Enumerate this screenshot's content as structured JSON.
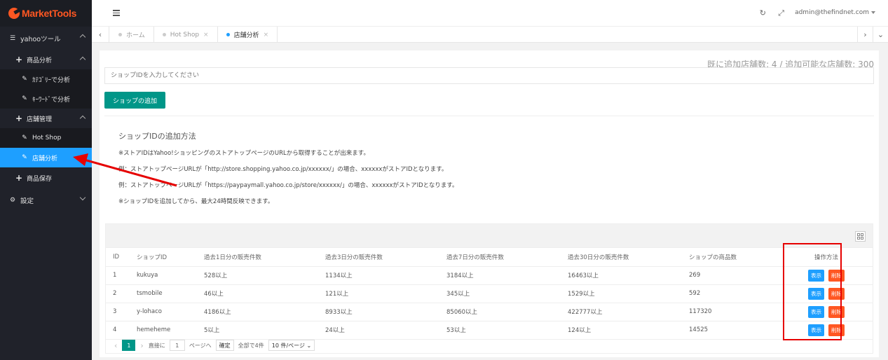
{
  "app": {
    "logo_text": "MarketTools"
  },
  "sidebar": {
    "groups": [
      {
        "label": "yahooツール",
        "icon": "sliders-icon"
      },
      {
        "label": "設定",
        "icon": "gear-icon"
      }
    ],
    "items": [
      {
        "label": "商品分析"
      },
      {
        "label": "ｶﾃｺﾞﾘｰで分析"
      },
      {
        "label": "ｷｰﾜｰﾄﾞで分析"
      },
      {
        "label": "店舗管理"
      },
      {
        "label": "Hot Shop"
      },
      {
        "label": "店舗分析"
      },
      {
        "label": "商品保存"
      }
    ]
  },
  "header": {
    "user": "admin@thefindnet.com"
  },
  "tabs": [
    {
      "label": "ホーム"
    },
    {
      "label": "Hot Shop"
    },
    {
      "label": "店舗分析"
    }
  ],
  "main": {
    "count_text": "既に追加店舗数: 4 / 追加可能な店舗数: 300",
    "input_placeholder": "ショップIDを入力してください",
    "add_button": "ショップの追加",
    "help": {
      "title": "ショップIDの追加方法",
      "lines": [
        "※ストアIDはYahoo!ショッピングのストアトップページのURLから取得することが出来ます。",
        "例：ストアトップページURLが「http://store.shopping.yahoo.co.jp/xxxxxx/」の場合、xxxxxxがストアIDとなります。",
        "例：ストアトップページURLが「https://paypaymall.yahoo.co.jp/store/xxxxxx/」の場合、xxxxxxがストアIDとなります。",
        "※ショップIDを追加してから、最大24時間反映できます。"
      ]
    }
  },
  "table": {
    "headers": [
      "ID",
      "ショップID",
      "過去1日分の販売件数",
      "過去3日分の販売件数",
      "過去7日分の販売件数",
      "過去30日分の販売件数",
      "ショップの商品数",
      "操作方法"
    ],
    "rows": [
      [
        "1",
        "kukuya",
        "528以上",
        "1134以上",
        "3184以上",
        "16463以上",
        "269"
      ],
      [
        "2",
        "tsmobile",
        "46以上",
        "121以上",
        "345以上",
        "1529以上",
        "592"
      ],
      [
        "3",
        "y-lohaco",
        "4186以上",
        "8933以上",
        "85060以上",
        "422777以上",
        "117320"
      ],
      [
        "4",
        "hemeheme",
        "5以上",
        "24以上",
        "53以上",
        "124以上",
        "14525"
      ]
    ],
    "show_label": "表示",
    "delete_label": "削除"
  },
  "pager": {
    "current": "1",
    "goto_label": "直接に",
    "goto_value": "1",
    "page_suffix": "ページへ",
    "confirm": "確定",
    "total": "全部で4件",
    "page_size": "10 件/ページ"
  },
  "colors": {
    "accent": "#1e9fff",
    "primary": "#009688",
    "danger": "#ff5722",
    "annotation": "#e60000"
  }
}
